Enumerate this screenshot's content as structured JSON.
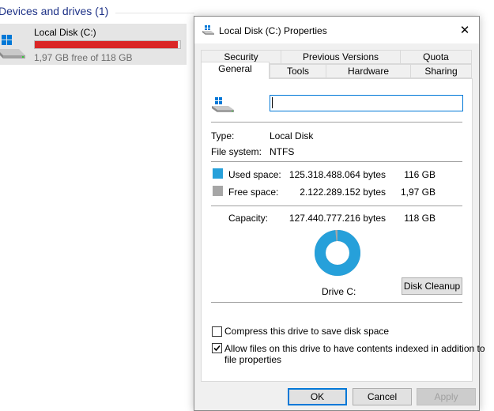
{
  "explorer": {
    "section_title": "Devices and drives (1)",
    "drive": {
      "name": "Local Disk (C:)",
      "free_text": "1,97 GB free of 118 GB",
      "used_fraction": 0.983,
      "bar_color": "#da2626"
    }
  },
  "dialog": {
    "title": "Local Disk (C:) Properties",
    "close_icon": "close-icon",
    "tabs_row1": [
      "Security",
      "Previous Versions",
      "Quota"
    ],
    "tabs_row2": [
      "General",
      "Tools",
      "Hardware",
      "Sharing"
    ],
    "active_tab": "General",
    "general": {
      "name_value": "",
      "type_label": "Type:",
      "type_value": "Local Disk",
      "fs_label": "File system:",
      "fs_value": "NTFS",
      "used_label": "Used space:",
      "used_bytes": "125.318.488.064 bytes",
      "used_size": "116 GB",
      "used_color": "#26a0da",
      "free_label": "Free space:",
      "free_bytes": "2.122.289.152 bytes",
      "free_size": "1,97 GB",
      "free_color": "#a6a6a6",
      "capacity_label": "Capacity:",
      "capacity_bytes": "127.440.777.216 bytes",
      "capacity_size": "118 GB",
      "used_fraction": 0.983,
      "drive_label": "Drive C:",
      "cleanup_button": "Disk Cleanup",
      "compress_label": "Compress this drive to save disk space",
      "compress_checked": false,
      "index_label_line1": "Allow files on this drive to have contents indexed in addition to",
      "index_label_line2": "file properties",
      "index_checked": true
    },
    "buttons": {
      "ok": "OK",
      "cancel": "Cancel",
      "apply": "Apply"
    }
  }
}
